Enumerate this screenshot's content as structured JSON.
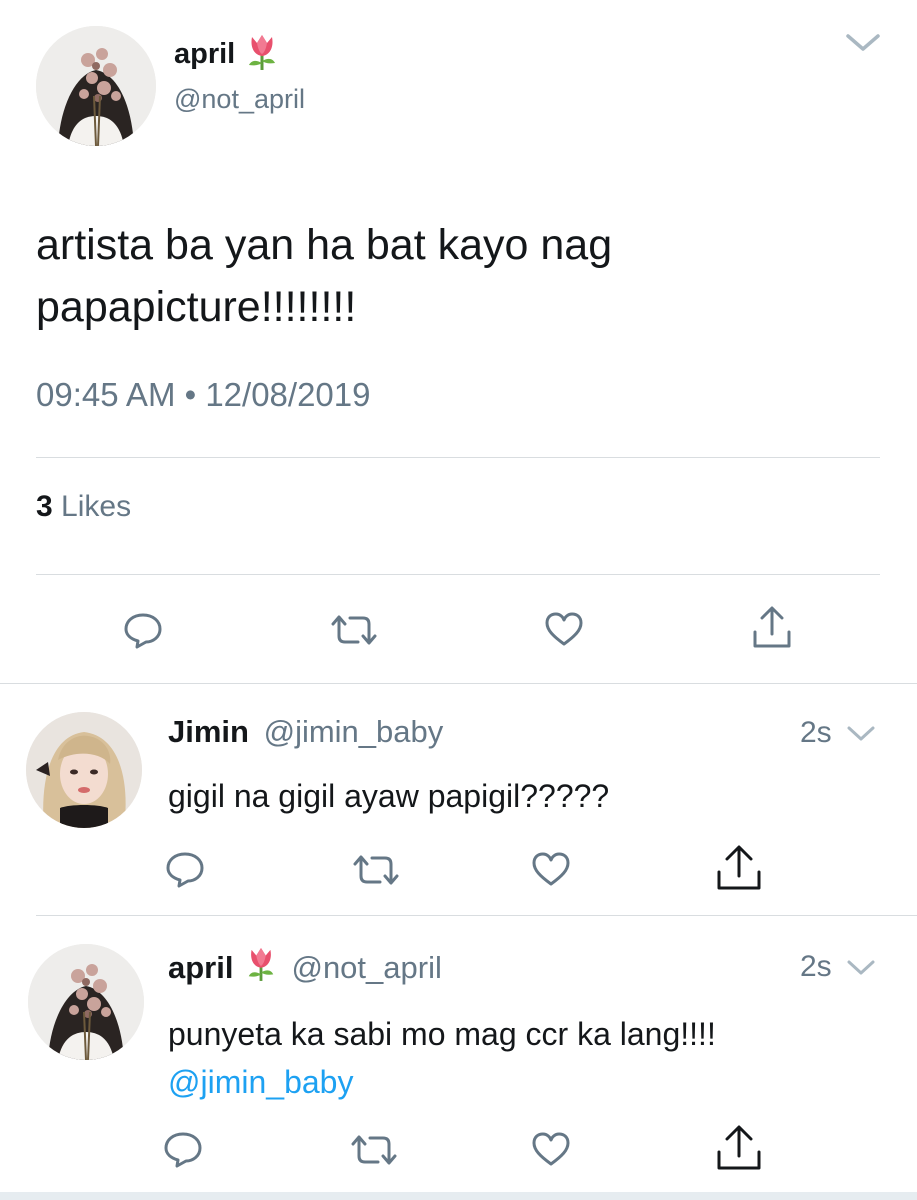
{
  "main_tweet": {
    "display_name": "april",
    "handle": "@not_april",
    "name_emoji": "tulip-emoji",
    "text": "artista ba yan ha bat kayo nag papapicture!!!!!!!!",
    "timestamp": "09:45 AM • 12/08/2019",
    "likes_count": "3",
    "likes_label": "Likes",
    "menu_icon": "chevron-down-icon",
    "actions": [
      "reply-icon",
      "retweet-icon",
      "like-icon",
      "share-icon"
    ]
  },
  "replies": [
    {
      "display_name": "Jimin",
      "handle": "@jimin_baby",
      "time": "2s",
      "text": "gigil na gigil ayaw papigil?????",
      "actions": [
        "reply-icon",
        "retweet-icon",
        "like-icon",
        "share-icon"
      ]
    },
    {
      "display_name": "april",
      "name_emoji": "tulip-emoji",
      "handle": "@not_april",
      "time": "2s",
      "text": "punyeta ka sabi mo mag ccr ka lang!!!!",
      "mention": "@jimin_baby",
      "actions": [
        "reply-icon",
        "retweet-icon",
        "like-icon",
        "share-icon"
      ]
    }
  ],
  "colors": {
    "text": "#14171a",
    "secondary": "#657786",
    "link": "#1da1f2",
    "divider": "#d9dde0"
  }
}
